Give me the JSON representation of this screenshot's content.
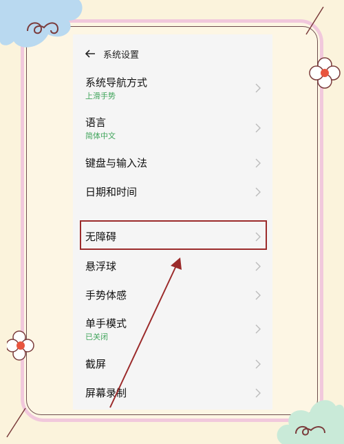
{
  "header": {
    "title": "系统设置"
  },
  "items": [
    {
      "title": "系统导航方式",
      "sub": "上滑手势"
    },
    {
      "title": "语言",
      "sub": "简体中文"
    },
    {
      "title": "键盘与输入法",
      "sub": ""
    },
    {
      "title": "日期和时间",
      "sub": ""
    },
    {
      "title": "无障碍",
      "sub": ""
    },
    {
      "title": "悬浮球",
      "sub": ""
    },
    {
      "title": "手势体感",
      "sub": ""
    },
    {
      "title": "单手模式",
      "sub": "已关闭"
    },
    {
      "title": "截屏",
      "sub": ""
    },
    {
      "title": "屏幕录制",
      "sub": ""
    }
  ],
  "colors": {
    "accent_green": "#3fa45a",
    "highlight_red": "#9b2a2a",
    "frame_pink": "#f1c8dc",
    "background": "#fbf3dc"
  },
  "icons": [
    "back-arrow-icon",
    "chevron-right-icon"
  ]
}
